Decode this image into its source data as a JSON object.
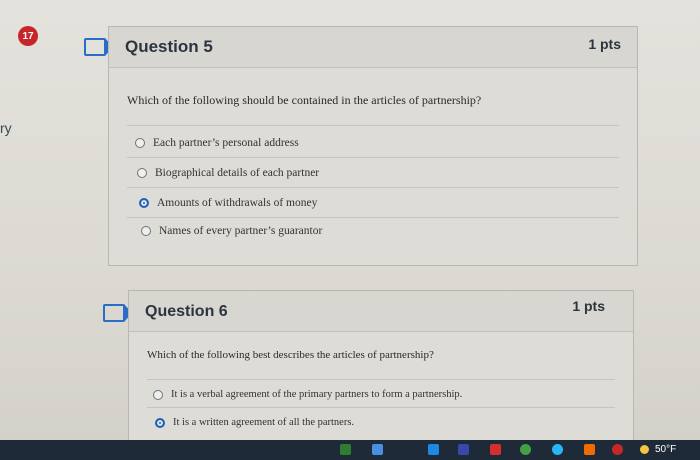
{
  "nav": {
    "badge_count": "17",
    "left_fragment": "ry"
  },
  "questions": [
    {
      "title": "Question 5",
      "points": "1 pts",
      "prompt": "Which of the following should be contained in the articles of partnership?",
      "options": [
        {
          "label": "Each partner’s personal address",
          "selected": false
        },
        {
          "label": "Biographical details of each partner",
          "selected": false
        },
        {
          "label": "Amounts of withdrawals of money",
          "selected": true
        },
        {
          "label": "Names of every partner’s guarantor",
          "selected": false
        }
      ]
    },
    {
      "title": "Question 6",
      "points": "1 pts",
      "prompt": "Which of the following best describes the articles of partnership?",
      "options": [
        {
          "label": "It is a verbal agreement of the primary partners to form a partnership.",
          "selected": false
        },
        {
          "label": "It is a written agreement of all the partners.",
          "selected": true
        }
      ]
    }
  ],
  "taskbar": {
    "temperature": "50°F"
  },
  "colors": {
    "accent": "#1f5fbf",
    "badge": "#c8252b",
    "flag": "#2b6dc6"
  }
}
